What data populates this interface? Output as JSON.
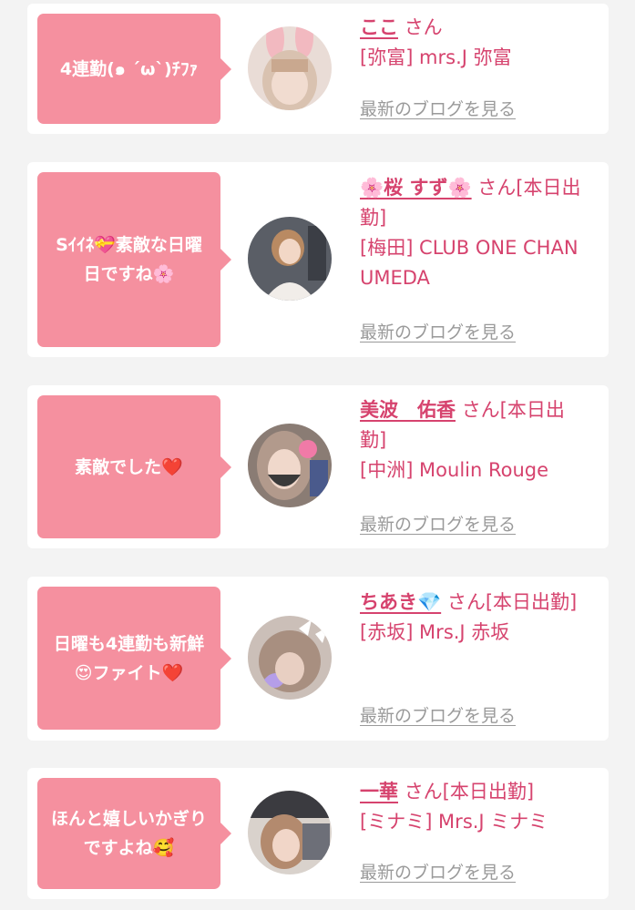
{
  "entries": [
    {
      "message": "4連勤(๑ ´ω`)ﾁﾌｧ",
      "name": "ここ",
      "honorific": "さん",
      "shop": "[弥富] mrs.J 弥富",
      "blog_link": "最新のブログを見る"
    },
    {
      "message": "Sｲｲﾈ💝素敵な日曜日ですね🌸",
      "name": "🌸桜 すず🌸",
      "honorific": "さん[本日出勤]",
      "shop": "[梅田] CLUB ONE CHAN UMEDA",
      "blog_link": "最新のブログを見る"
    },
    {
      "message": "素敵でした❤️",
      "name": "美波　佑香",
      "honorific": "さん[本日出勤]",
      "shop": "[中洲] Moulin Rouge",
      "blog_link": "最新のブログを見る"
    },
    {
      "message": "日曜も4連勤も新鮮😍ファイト❤️",
      "name": "ちあき💎",
      "honorific": "さん[本日出勤]",
      "shop": "[赤坂] Mrs.J 赤坂",
      "blog_link": "最新のブログを見る"
    },
    {
      "message": "ほんと嬉しいかぎりですよね🥰",
      "name": "一華",
      "honorific": "さん[本日出勤]",
      "shop": "[ミナミ] Mrs.J ミナミ",
      "blog_link": "最新のブログを見る"
    }
  ],
  "colors": {
    "bubble": "#f5909f",
    "name": "#d6436e",
    "link": "#9a9a9a",
    "background": "#f3f3f3"
  }
}
